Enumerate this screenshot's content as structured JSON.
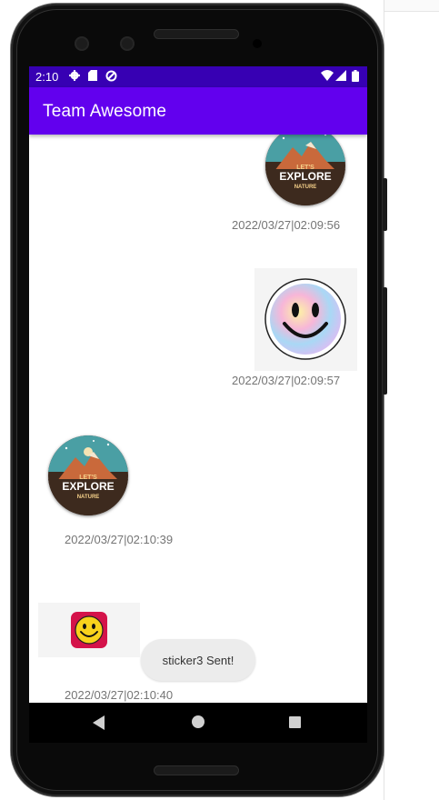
{
  "status_bar": {
    "time": "2:10",
    "icons": [
      "settings-gear-icon",
      "sd-card-icon",
      "sync-icon",
      "wifi-icon",
      "signal-icon",
      "battery-icon"
    ]
  },
  "app_bar": {
    "title": "Team Awesome"
  },
  "messages": [
    {
      "side": "right",
      "sticker": "explore-nature-badge",
      "sticker_text": {
        "top": "LET'S",
        "main": "EXPLORE",
        "bottom": "NATURE"
      },
      "timestamp": "2022/03/27|02:09:56"
    },
    {
      "side": "right",
      "sticker": "tie-dye-smiley",
      "timestamp": "2022/03/27|02:09:57"
    },
    {
      "side": "left",
      "sticker": "explore-nature-badge",
      "sticker_text": {
        "top": "LET'S",
        "main": "EXPLORE",
        "bottom": "NATURE"
      },
      "timestamp": "2022/03/27|02:10:39"
    },
    {
      "side": "left",
      "sticker": "red-square-smiley",
      "timestamp": "2022/03/27|02:10:40"
    }
  ],
  "toast": {
    "text": "sticker3 Sent!"
  },
  "nav_bar": {
    "icons": [
      "back-icon",
      "home-icon",
      "recents-icon"
    ]
  },
  "colors": {
    "status_bar": "#3700b3",
    "app_bar": "#6200ee",
    "timestamp": "#757575"
  }
}
